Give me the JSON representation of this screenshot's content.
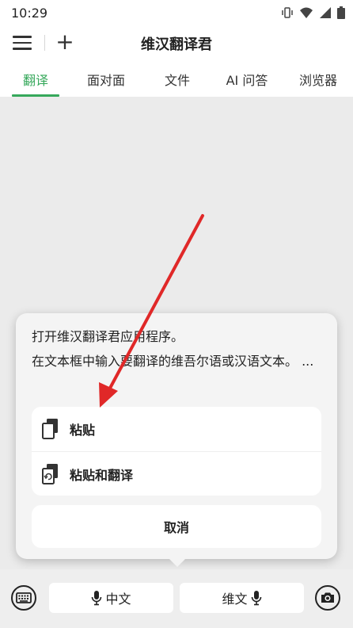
{
  "status_bar": {
    "time": "10:29",
    "icons": [
      "vibrate-icon",
      "wifi-icon",
      "signal-icon",
      "battery-icon"
    ]
  },
  "header": {
    "title": "维汉翻译君",
    "menu_icon": "hamburger-menu-icon",
    "add_icon": "plus-icon"
  },
  "tabs": [
    {
      "label": "翻译",
      "active": true
    },
    {
      "label": "面对面",
      "active": false
    },
    {
      "label": "文件",
      "active": false
    },
    {
      "label": "AI 问答",
      "active": false
    },
    {
      "label": "浏览器",
      "active": false
    }
  ],
  "popup": {
    "line1": "打开维汉翻译君应用程序。",
    "line2": "在文本框中输入要翻译的维吾尔语或汉语文本。 ...",
    "menu": [
      {
        "label": "粘贴",
        "icon": "paste-icon"
      },
      {
        "label": "粘贴和翻译",
        "icon": "paste-translate-icon"
      }
    ],
    "cancel": "取消"
  },
  "bottom_bar": {
    "keyboard_icon": "keyboard-icon",
    "left_lang": "中文",
    "right_lang": "维文",
    "camera_icon": "camera-icon"
  },
  "colors": {
    "accent": "#36a85b",
    "arrow": "#e02828"
  }
}
